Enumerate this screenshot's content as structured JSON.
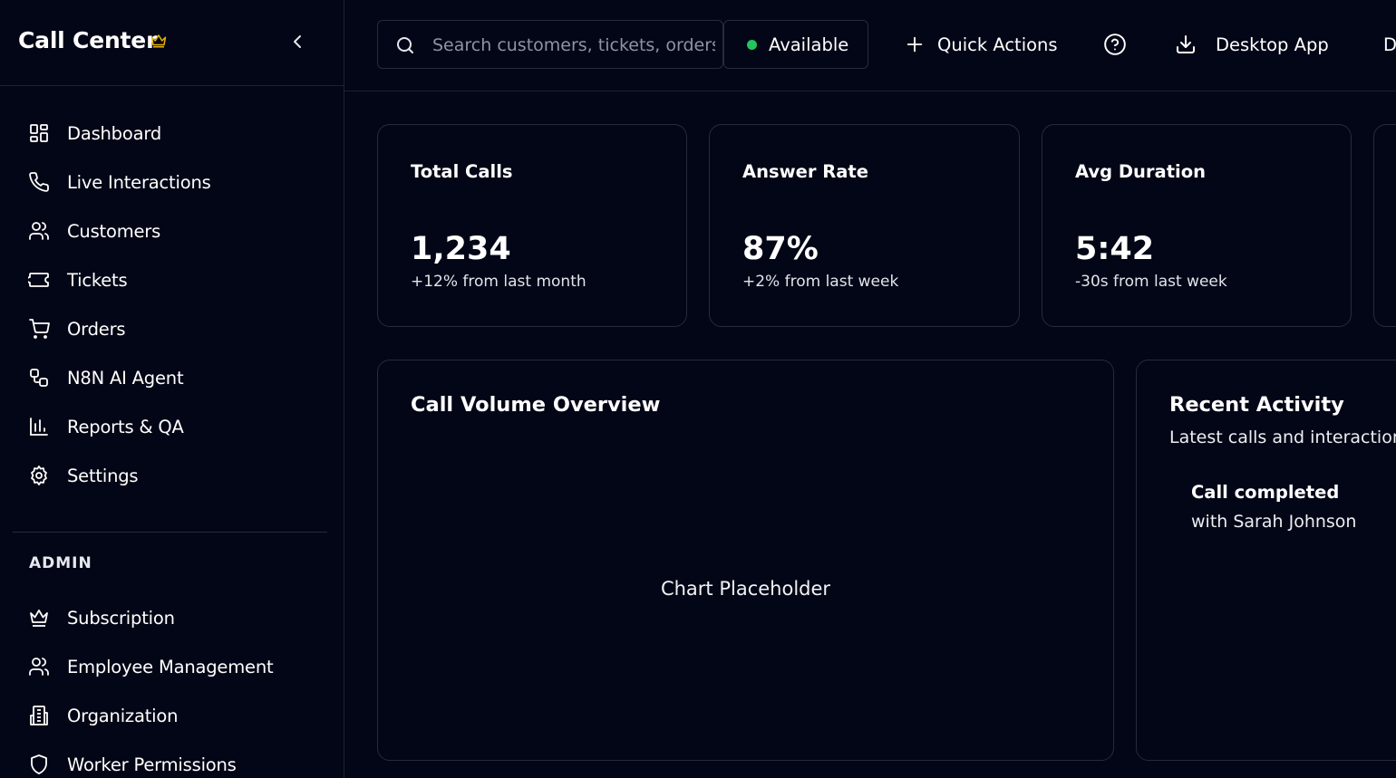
{
  "sidebar": {
    "brand": "Call Center",
    "brand_badge_icon": "crown-icon",
    "accent": "#eab308",
    "collapse_icon": "chevron-left-icon",
    "items": [
      {
        "label": "Dashboard",
        "icon": "dashboard-icon"
      },
      {
        "label": "Live Interactions",
        "icon": "phone-icon"
      },
      {
        "label": "Customers",
        "icon": "users-icon"
      },
      {
        "label": "Tickets",
        "icon": "ticket-icon"
      },
      {
        "label": "Orders",
        "icon": "cart-icon"
      },
      {
        "label": "N8N AI Agent",
        "icon": "workflow-icon"
      },
      {
        "label": "Reports & QA",
        "icon": "bar-chart-icon"
      },
      {
        "label": "Settings",
        "icon": "gear-icon"
      }
    ],
    "admin_label": "ADMIN",
    "admin_items": [
      {
        "label": "Subscription",
        "icon": "crown-icon"
      },
      {
        "label": "Employee Management",
        "icon": "users-icon"
      },
      {
        "label": "Organization",
        "icon": "building-icon"
      },
      {
        "label": "Worker Permissions",
        "icon": "shield-icon"
      }
    ]
  },
  "topbar": {
    "search_placeholder": "Search customers, tickets, orders...",
    "status": {
      "label": "Available",
      "color": "#22c55e"
    },
    "quick_actions": "Quick Actions",
    "help_icon": "help-circle-icon",
    "desktop_app": "Desktop App",
    "overflow_label": "D"
  },
  "stats": [
    {
      "title": "Total Calls",
      "value": "1,234",
      "delta": "+12% from last month"
    },
    {
      "title": "Answer Rate",
      "value": "87%",
      "delta": "+2% from last week"
    },
    {
      "title": "Avg Duration",
      "value": "5:42",
      "delta": "-30s from last week"
    }
  ],
  "call_volume": {
    "title": "Call Volume Overview",
    "placeholder": "Chart Placeholder"
  },
  "recent_activity": {
    "title": "Recent Activity",
    "subtitle": "Latest calls and interactions",
    "items": [
      {
        "title": "Call completed",
        "detail": "with Sarah Johnson"
      }
    ]
  }
}
